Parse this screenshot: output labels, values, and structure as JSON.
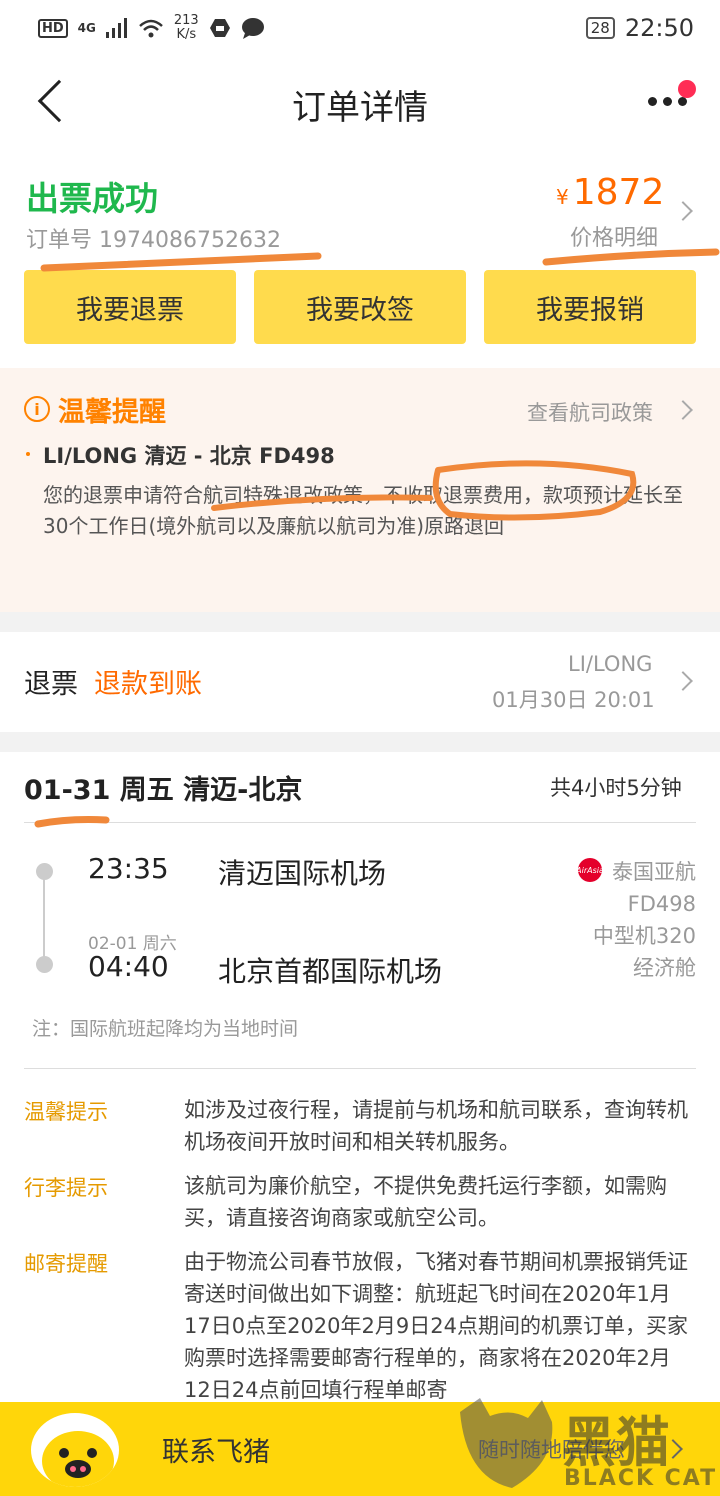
{
  "status_bar": {
    "hd": "HD",
    "network": "4G",
    "speed": "213",
    "speed_unit": "K/s",
    "battery": "28",
    "time": "22:50"
  },
  "header": {
    "title": "订单详情"
  },
  "order": {
    "status": "出票成功",
    "order_no": "订单号 1974086752632",
    "currency": "¥",
    "price": "1872",
    "price_detail": "价格明细"
  },
  "actions": [
    "我要退票",
    "我要改签",
    "我要报销"
  ],
  "notice": {
    "title": "温馨提醒",
    "policy_link": "查看航司政策",
    "flight": "LI/LONG 清迈 - 北京 FD498",
    "text": "您的退票申请符合航司特殊退改政策，不收取退票费用，款项预计延长至30个工作日(境外航司以及廉航以航司为准)原路退回"
  },
  "refund": {
    "label": "退票",
    "status": "退款到账",
    "passenger": "LI/LONG",
    "time": "01月30日 20:01"
  },
  "flight": {
    "date": "01-31 周五 清迈-北京",
    "duration": "共4小时5分钟",
    "dep_time": "23:35",
    "dep_airport": "清迈国际机场",
    "arr_date": "02-01 周六",
    "arr_time": "04:40",
    "arr_airport": "北京首都国际机场",
    "airline": "泰国亚航",
    "flight_no": "FD498",
    "aircraft": "中型机320",
    "cabin": "经济舱",
    "logo_text": "AirAsia",
    "note": "注：国际航班起降均为当地时间"
  },
  "tips": [
    {
      "label": "温馨提示",
      "text": "如涉及过夜行程，请提前与机场和航司联系，查询转机机场夜间开放时间和相关转机服务。"
    },
    {
      "label": "行李提示",
      "text": "该航司为廉价航空，不提供免费托运行李额，如需购买，请直接咨询商家或航空公司。"
    },
    {
      "label": "邮寄提醒",
      "text": "由于物流公司春节放假，飞猪对春节期间机票报销凭证寄送时间做出如下调整：航班起飞时间在2020年1月17日0点至2020年2月9日24点期间的机票订单，买家购票时选择需要邮寄行程单的，商家将在2020年2月12日24点前回填行程单邮寄"
    }
  ],
  "footer": {
    "contact": "联系飞猪",
    "slogan": "随时随地陪伴您"
  },
  "watermark": {
    "cn": "黑猫",
    "en": "BLACK CAT"
  },
  "colors": {
    "green": "#1fb84d",
    "orange": "#ff6a00",
    "yellow": "#ffdb4d",
    "annotation": "#f0883a"
  }
}
